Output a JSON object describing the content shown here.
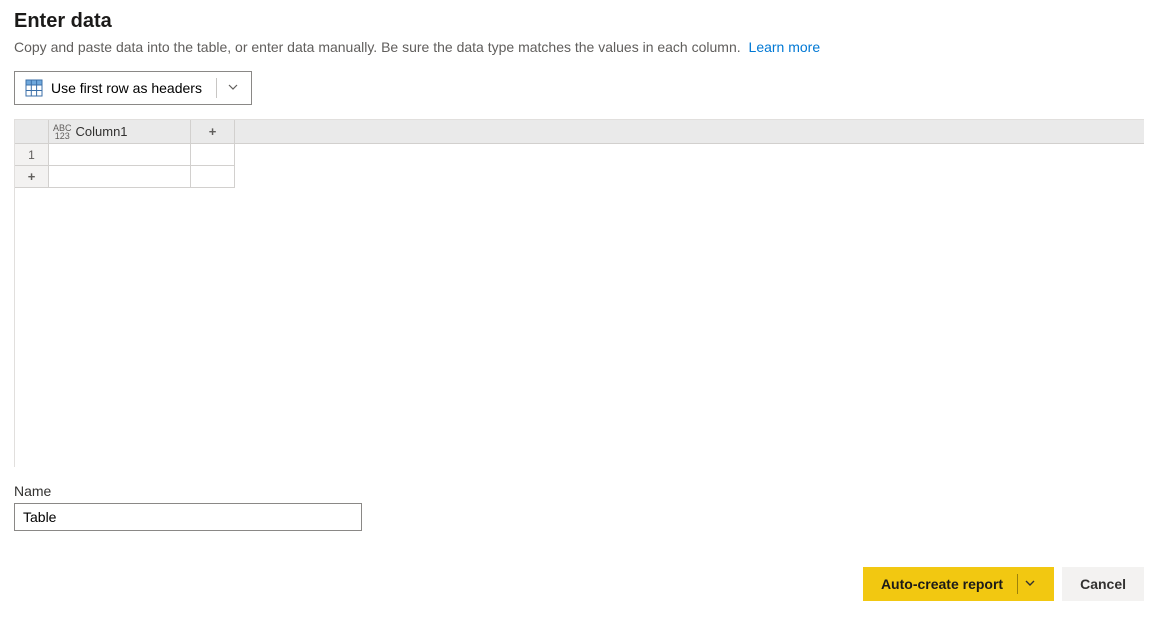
{
  "header": {
    "title": "Enter data",
    "subtitle": "Copy and paste data into the table, or enter data manually. Be sure the data type matches the values in each column.",
    "learn_more": "Learn more"
  },
  "toolbar": {
    "use_first_row_label": "Use first row as headers"
  },
  "grid": {
    "columns": [
      "Column1"
    ],
    "type_icon_top": "ABC",
    "type_icon_bottom": "123",
    "rows": [
      1
    ],
    "add_col": "+",
    "add_row": "+"
  },
  "form": {
    "name_label": "Name",
    "name_value": "Table"
  },
  "actions": {
    "primary": "Auto-create report",
    "cancel": "Cancel"
  }
}
